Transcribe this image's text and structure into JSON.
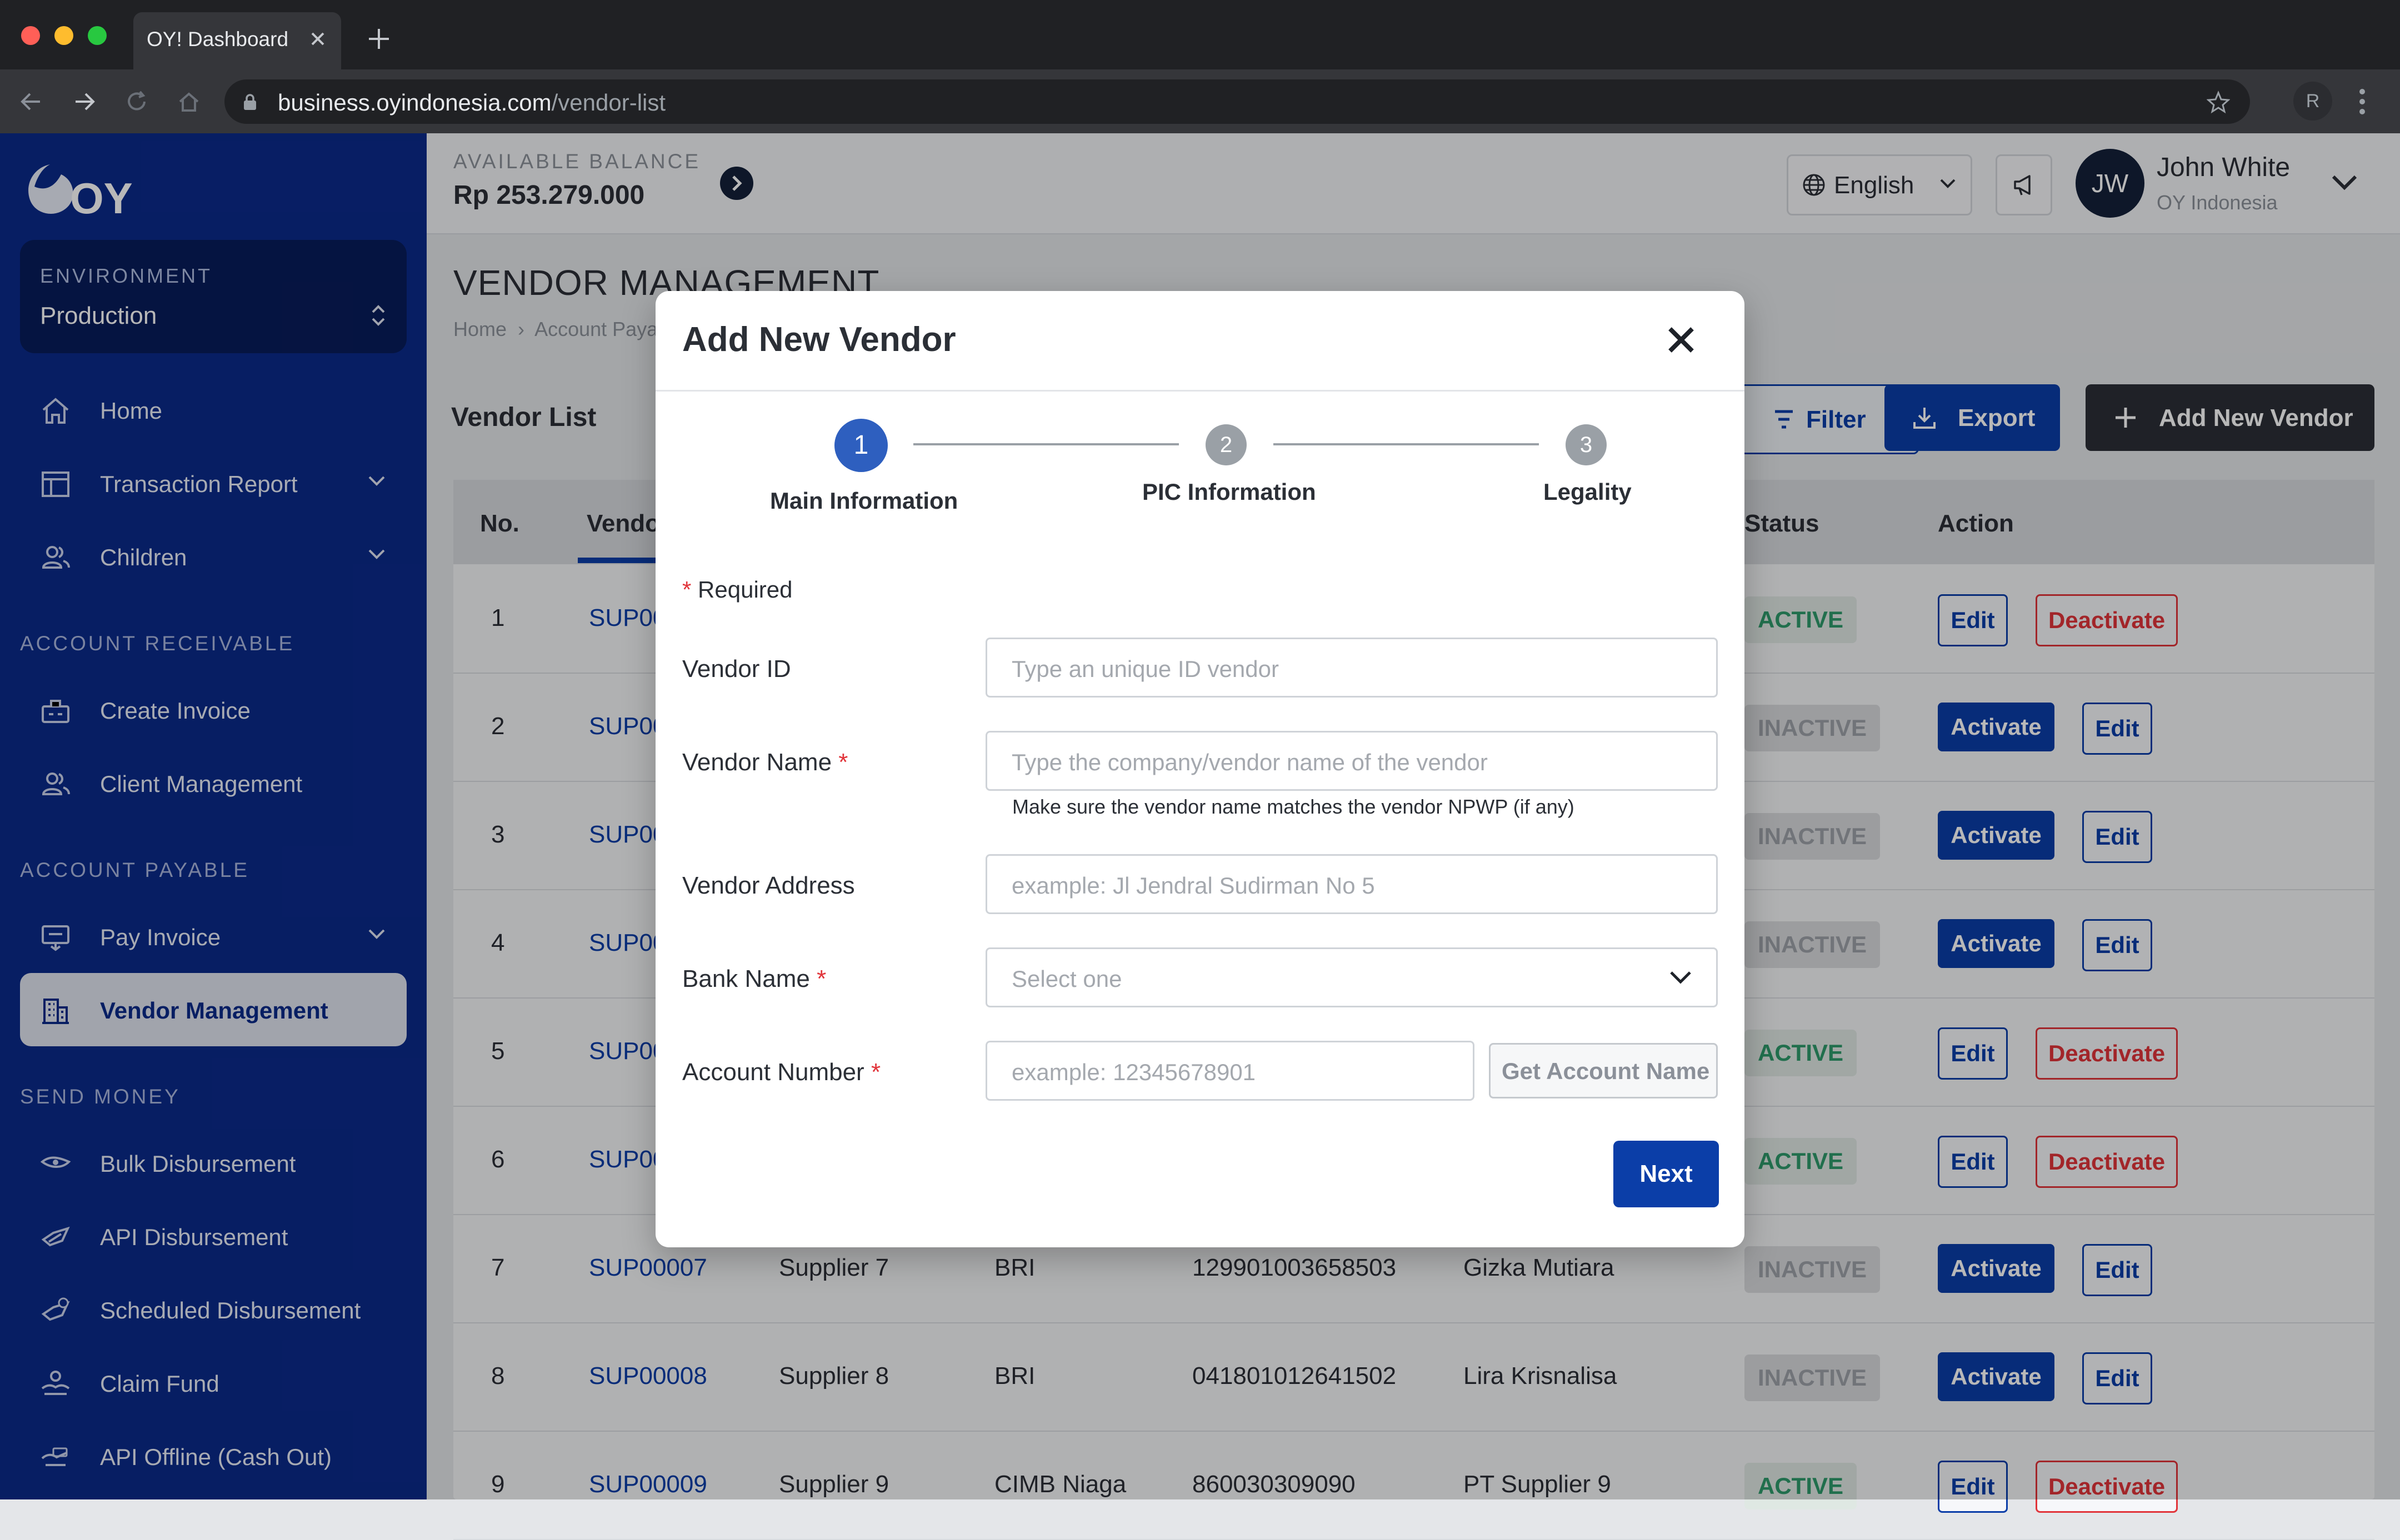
{
  "browser": {
    "tab_title": "OY! Dashboard",
    "url_domain": "business.oyindonesia.com",
    "url_path": "/vendor-list",
    "profile_initial": "R"
  },
  "sidebar": {
    "logo_text": "OY!",
    "environment_label": "ENVIRONMENT",
    "environment_value": "Production",
    "items": [
      {
        "label": "Home",
        "icon": "home-icon"
      },
      {
        "label": "Transaction Report",
        "icon": "table-icon"
      },
      {
        "label": "Children",
        "icon": "users-icon"
      }
    ],
    "sections": [
      {
        "label": "ACCOUNT RECEIVABLE",
        "items": [
          {
            "label": "Create Invoice",
            "icon": "cash-register-icon"
          },
          {
            "label": "Client Management",
            "icon": "users-icon"
          }
        ]
      },
      {
        "label": "ACCOUNT PAYABLE",
        "items": [
          {
            "label": "Pay Invoice",
            "icon": "pay-invoice-icon"
          },
          {
            "label": "Vendor Management",
            "icon": "building-icon",
            "active": true
          }
        ]
      },
      {
        "label": "SEND MONEY",
        "items": [
          {
            "label": "Bulk Disbursement",
            "icon": "send-money-icon"
          },
          {
            "label": "API Disbursement",
            "icon": "api-send-icon"
          },
          {
            "label": "Scheduled Disbursement",
            "icon": "scheduled-send-icon"
          },
          {
            "label": "Claim Fund",
            "icon": "claim-fund-icon"
          },
          {
            "label": "API Offline (Cash Out)",
            "icon": "cash-out-icon"
          }
        ]
      }
    ]
  },
  "header": {
    "balance_label": "AVAILABLE BALANCE",
    "balance_value": "Rp 253.279.000",
    "language": "English",
    "user_initials": "JW",
    "user_name": "John White",
    "user_org": "OY Indonesia"
  },
  "page": {
    "title": "VENDOR MANAGEMENT",
    "breadcrumb_home": "Home",
    "breadcrumb_sep": "›",
    "breadcrumb_current": "Account Paya",
    "list_title": "Vendor List",
    "filter_label": "Filter",
    "export_label": "Export",
    "add_vendor_label": "Add New Vendor"
  },
  "table": {
    "columns": [
      "No.",
      "Vendo",
      "Status",
      "Action"
    ],
    "rows": [
      {
        "no": "1",
        "id": "SUP00",
        "supplier": "",
        "bank": "",
        "account": "",
        "pic": "",
        "status": "ACTIVE"
      },
      {
        "no": "2",
        "id": "SUP00",
        "supplier": "",
        "bank": "",
        "account": "",
        "pic": "",
        "status": "INACTIVE"
      },
      {
        "no": "3",
        "id": "SUP00",
        "supplier": "",
        "bank": "",
        "account": "",
        "pic": "",
        "status": "INACTIVE"
      },
      {
        "no": "4",
        "id": "SUP00",
        "supplier": "",
        "bank": "",
        "account": "",
        "pic": "",
        "status": "INACTIVE"
      },
      {
        "no": "5",
        "id": "SUP00",
        "supplier": "",
        "bank": "",
        "account": "",
        "pic": "",
        "status": "ACTIVE"
      },
      {
        "no": "6",
        "id": "SUP00",
        "supplier": "",
        "bank": "",
        "account": "",
        "pic": "",
        "status": "ACTIVE"
      },
      {
        "no": "7",
        "id": "SUP00007",
        "supplier": "Supplier 7",
        "bank": "BRI",
        "account": "129901003658503",
        "pic": "Gizka Mutiara",
        "status": "INACTIVE"
      },
      {
        "no": "8",
        "id": "SUP00008",
        "supplier": "Supplier 8",
        "bank": "BRI",
        "account": "041801012641502",
        "pic": "Lira Krisnalisa",
        "status": "INACTIVE"
      },
      {
        "no": "9",
        "id": "SUP00009",
        "supplier": "Supplier 9",
        "bank": "CIMB Niaga",
        "account": "860030309090",
        "pic": "PT Supplier 9",
        "status": "ACTIVE"
      }
    ],
    "action_labels": {
      "edit": "Edit",
      "deactivate": "Deactivate",
      "activate": "Activate"
    }
  },
  "modal": {
    "title": "Add New Vendor",
    "steps": [
      {
        "number": "1",
        "label": "Main Information"
      },
      {
        "number": "2",
        "label": "PIC Information"
      },
      {
        "number": "3",
        "label": "Legality"
      }
    ],
    "required_mark": "*",
    "required_note": "Required",
    "fields": {
      "vendor_id": {
        "label": "Vendor ID",
        "placeholder": "Type an unique ID vendor"
      },
      "vendor_name": {
        "label": "Vendor Name",
        "placeholder": "Type the company/vendor name of the vendor",
        "hint": "Make sure the vendor name matches the vendor NPWP (if any)"
      },
      "vendor_address": {
        "label": "Vendor Address",
        "placeholder": "example: Jl Jendral Sudirman No 5"
      },
      "bank_name": {
        "label": "Bank Name",
        "placeholder": "Select one"
      },
      "account_number": {
        "label": "Account Number",
        "placeholder": "example: 12345678901"
      }
    },
    "get_account_name_label": "Get Account Name",
    "next_label": "Next"
  },
  "colors": {
    "sidebar_bg": "#0b2a8a",
    "primary": "#0b3ea8",
    "danger": "#e1343a",
    "success": "#2f9a6b"
  }
}
